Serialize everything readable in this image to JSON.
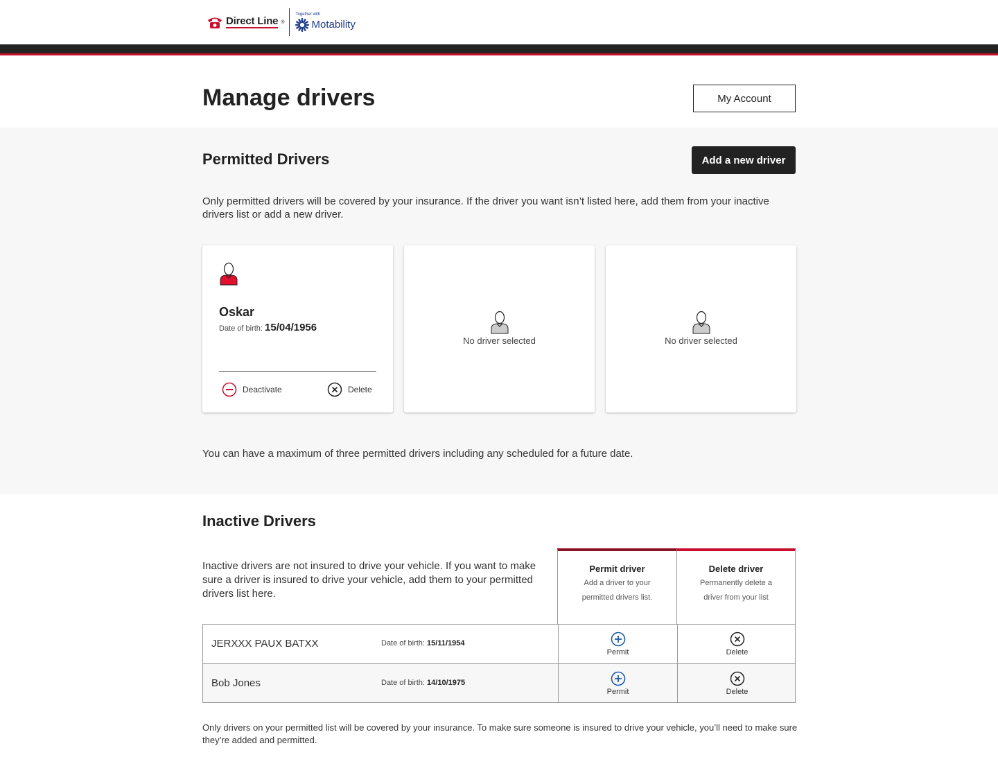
{
  "header": {
    "brand": "Direct Line",
    "partner_tag": "Together with",
    "partner": "Motability",
    "colors": {
      "brand_red": "#c8102e",
      "partner_blue": "#1e3b8a",
      "bar": "#232323"
    }
  },
  "page": {
    "title": "Manage drivers",
    "my_account_label": "My Account"
  },
  "permitted": {
    "title": "Permitted Drivers",
    "add_label": "Add a new driver",
    "description": "Only permitted drivers will be covered by your insurance. If the driver you want isn’t listed here, add them from your inactive drivers list or add a new driver.",
    "driver": {
      "name": "Oskar",
      "dob_label": "Date of birth:",
      "dob": "15/04/1956",
      "deactivate_label": "Deactivate",
      "delete_label": "Delete"
    },
    "empty_slots": [
      "No driver selected",
      "No driver selected"
    ],
    "max_note": "You can have a maximum of three permitted drivers including any scheduled for a future date."
  },
  "inactive": {
    "title": "Inactive Drivers",
    "description": "Inactive drivers are not insured to drive your vehicle. If you want to make sure a driver is insured to drive your vehicle, add them to your permitted drivers list here.",
    "permit_col": {
      "title": "Permit driver",
      "subtitle": "Add a driver to your permitted drivers list."
    },
    "delete_col": {
      "title": "Delete driver",
      "subtitle": "Permanently delete a driver from your list"
    },
    "dob_label": "Date of birth:",
    "permit_label": "Permit",
    "delete_label": "Delete",
    "rows": [
      {
        "name": "JERXXX PAUX BATXX",
        "dob": "15/11/1954"
      },
      {
        "name": "Bob Jones",
        "dob": "14/10/1975"
      }
    ],
    "footer": "Only drivers on your permitted list will be covered by your insurance. To make sure someone is insured to drive your vehicle, you’ll need to make sure they’re added and permitted."
  }
}
